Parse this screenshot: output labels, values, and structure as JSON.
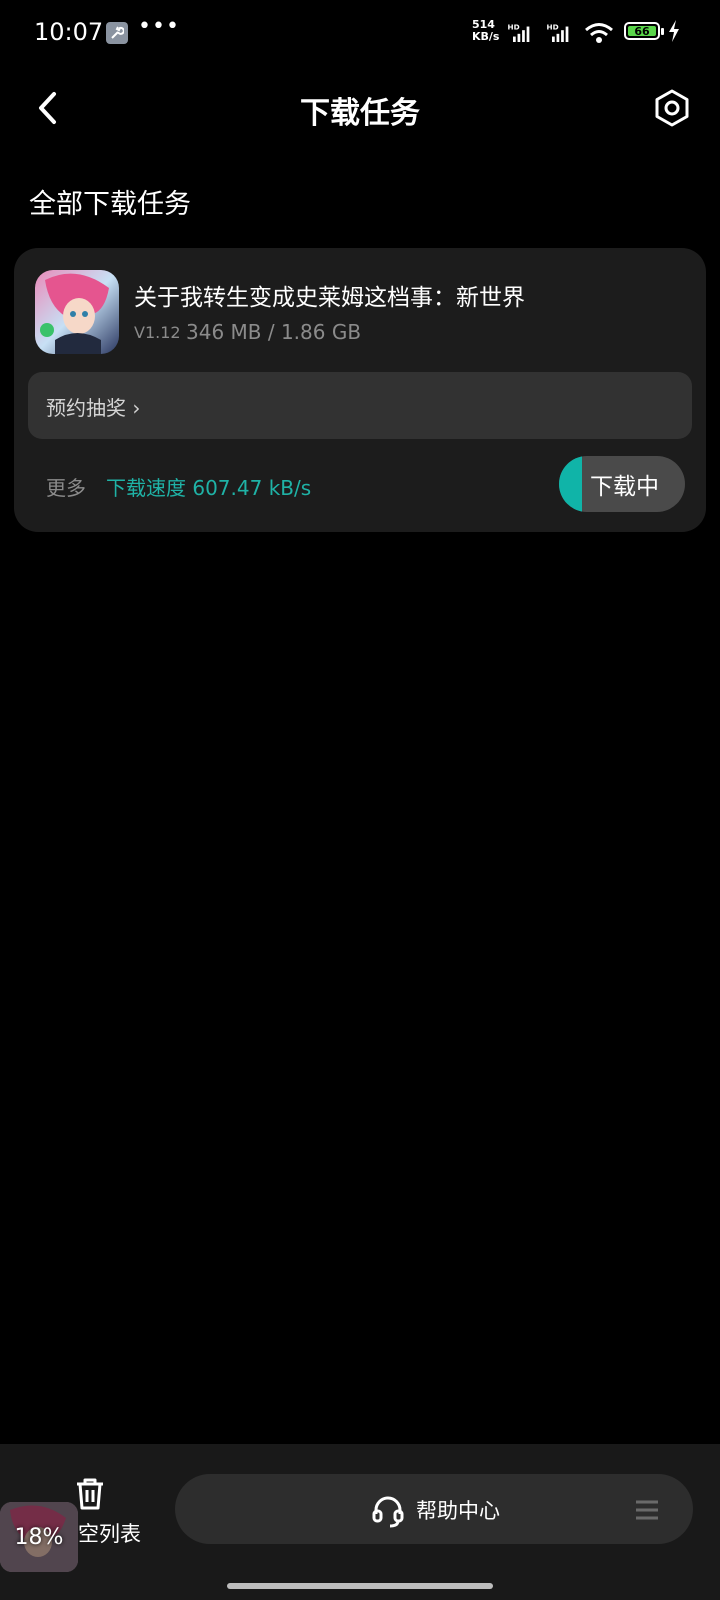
{
  "status_bar": {
    "time": "10:07",
    "network_speed_value": "514",
    "network_speed_unit": "KB/s",
    "battery_level": "66",
    "icons": [
      "wrench-icon",
      "more-dots-icon",
      "hd-signal-icon",
      "hd-signal-icon",
      "wifi-icon",
      "battery-icon",
      "charging-icon"
    ]
  },
  "header": {
    "title": "下载任务",
    "back_icon": "chevron-left-icon",
    "settings_icon": "hexagon-settings-icon"
  },
  "section": {
    "title": "全部下载任务"
  },
  "task": {
    "app_name": "关于我转生变成史莱姆这档事：新世界",
    "version": "V1.12",
    "size": "346 MB / 1.86 GB",
    "promo_label": "预约抽奖 ›",
    "more_label": "更多",
    "speed_label": "下载速度 607.47 kB/s",
    "button_label": "下载中",
    "progress_fraction": 0.186
  },
  "bottom": {
    "clear_label": "空列表",
    "help_label": "帮助中心",
    "float_percent": "18%"
  },
  "colors": {
    "accent": "#10b4a8",
    "background": "#000000",
    "card": "#1c1c1c"
  }
}
